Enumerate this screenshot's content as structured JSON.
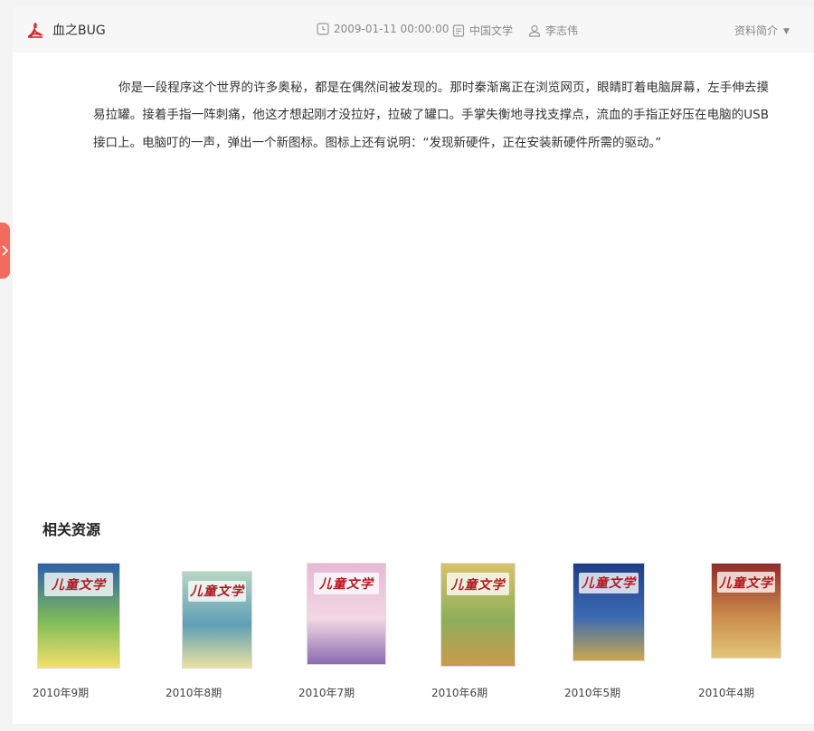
{
  "header": {
    "file_icon": "pdf-icon",
    "title": "血之BUG",
    "date": "2009-01-11 00:00:00",
    "date_icon": "clock-icon",
    "category": "中国文学",
    "category_icon": "document-icon",
    "author": "李志伟",
    "author_icon": "user-icon",
    "info_toggle": "资料简介",
    "info_toggle_icon": "triangle-down-icon"
  },
  "side_tab": {
    "icon": "chevron-right-icon"
  },
  "article": {
    "text": "你是一段程序这个世界的许多奥秘，都是在偶然间被发现的。那时秦渐离正在浏览网页，眼睛盯着电脑屏幕，左手伸去摸易拉罐。接着手指一阵刺痛，他这才想起刚才没拉好，拉破了罐口。手掌失衡地寻找支撑点，流血的手指正好压在电脑的USB接口上。电脑叮的一声，弹出一个新图标。图标上还有说明：“发现新硬件，正在安装新硬件所需的驱动。”"
  },
  "related": {
    "title": "相关资源",
    "items": [
      {
        "label": "2010年9期",
        "cover_text": "儿童文学",
        "cover_colors": [
          "#2d5fa8",
          "#7dbb5a",
          "#f3e06a"
        ]
      },
      {
        "label": "2010年8期",
        "cover_text": "儿童文学",
        "cover_colors": [
          "#b7d6c2",
          "#5f9fb6",
          "#e9e1a0"
        ]
      },
      {
        "label": "2010年7期",
        "cover_text": "儿童文学",
        "cover_colors": [
          "#e6b9d3",
          "#f2d7e4",
          "#8a6bb0"
        ]
      },
      {
        "label": "2010年6期",
        "cover_text": "儿童文学",
        "cover_colors": [
          "#d7c36a",
          "#8fae5a",
          "#c99a4c"
        ]
      },
      {
        "label": "2010年5期",
        "cover_text": "儿童文学",
        "cover_colors": [
          "#1f3d86",
          "#3b6bb3",
          "#c9a84e"
        ]
      },
      {
        "label": "2010年4期",
        "cover_text": "儿童文学",
        "cover_colors": [
          "#8f2b2b",
          "#c98a4a",
          "#e2c67a"
        ]
      }
    ]
  }
}
